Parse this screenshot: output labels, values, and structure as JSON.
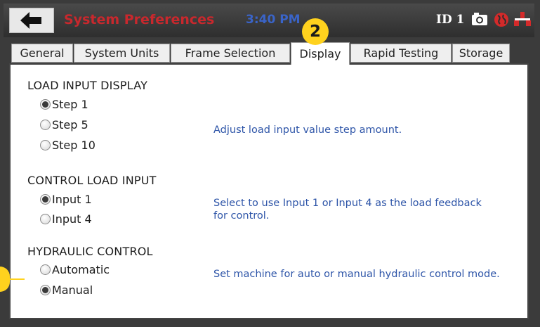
{
  "header": {
    "title": "System Preferences",
    "time": "3:40 PM",
    "id_label": "ID 1",
    "icons": [
      "back-arrow-icon",
      "camera-icon",
      "globe-icon",
      "network-icon"
    ]
  },
  "callouts": {
    "top": "2"
  },
  "tabs": [
    {
      "label": "General",
      "active": false
    },
    {
      "label": "System Units",
      "active": false
    },
    {
      "label": "Frame Selection",
      "active": false
    },
    {
      "label": "Display",
      "active": true
    },
    {
      "label": "Rapid Testing",
      "active": false
    },
    {
      "label": "Storage",
      "active": false
    }
  ],
  "sections": [
    {
      "title": "LOAD INPUT DISPLAY",
      "options": [
        {
          "label": "Step 1",
          "checked": true
        },
        {
          "label": "Step 5",
          "checked": false
        },
        {
          "label": "Step 10",
          "checked": false
        }
      ],
      "description": "Adjust load input value step amount."
    },
    {
      "title": "CONTROL LOAD INPUT",
      "options": [
        {
          "label": "Input 1",
          "checked": true
        },
        {
          "label": "Input 4",
          "checked": false
        }
      ],
      "description": "Select to use Input 1 or Input 4 as the load feedback for control."
    },
    {
      "title": "HYDRAULIC CONTROL",
      "options": [
        {
          "label": "Automatic",
          "checked": false
        },
        {
          "label": "Manual",
          "checked": true
        }
      ],
      "description": "Set machine for auto or manual hydraulic control mode."
    }
  ],
  "colors": {
    "title": "#c8282d",
    "time": "#3a64c8",
    "description": "#2e55a8",
    "callout": "#ffd21e",
    "header_bg": "#3b3b3b"
  }
}
